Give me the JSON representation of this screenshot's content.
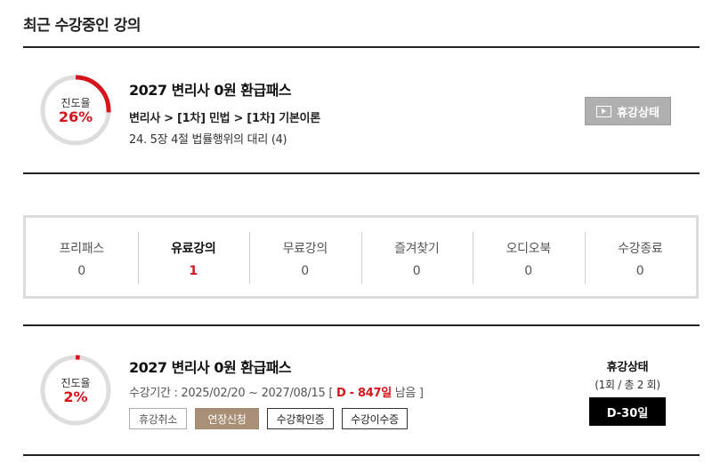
{
  "section": {
    "title": "최근 수강중인 강의"
  },
  "recent_course": {
    "progress_label": "진도율",
    "progress_text": "26%",
    "progress_fraction": 0.26,
    "title": "2027 변리사 0원 환급패스",
    "path": "변리사 > [1차] 민법 > [1차] 기본이론",
    "lecture": "24. 5장 4절 법률행위의 대리 (4)",
    "pause_button": "휴강상태"
  },
  "tabs": [
    {
      "label": "프리패스",
      "count": "0"
    },
    {
      "label": "유료강의",
      "count": "1"
    },
    {
      "label": "무료강의",
      "count": "0"
    },
    {
      "label": "즐겨찾기",
      "count": "0"
    },
    {
      "label": "오디오북",
      "count": "0"
    },
    {
      "label": "수강종료",
      "count": "0"
    }
  ],
  "active_tab": "유료강의",
  "course_item": {
    "progress_label": "진도율",
    "progress_text": "2%",
    "progress_fraction": 0.02,
    "title": "2027 변리사 0원 환급패스",
    "period_prefix": "수강기간 : 2025/02/20 ~ 2027/08/15 [ ",
    "dday_text": "D - 847일",
    "period_suffix": " 남음 ]",
    "buttons": {
      "cancel": "휴강취소",
      "extend": "연장신청",
      "confirm": "수강확인증",
      "transfer": "수강이수증"
    },
    "status_title": "휴강상태",
    "status_count": "(1회 / 총 2 회)",
    "dday_box": "D-30일"
  },
  "colors": {
    "accent_red": "#d7131b",
    "ring_track": "#dddddd",
    "extend_button": "#a98f76",
    "pause_button": "#b0b0b0"
  }
}
